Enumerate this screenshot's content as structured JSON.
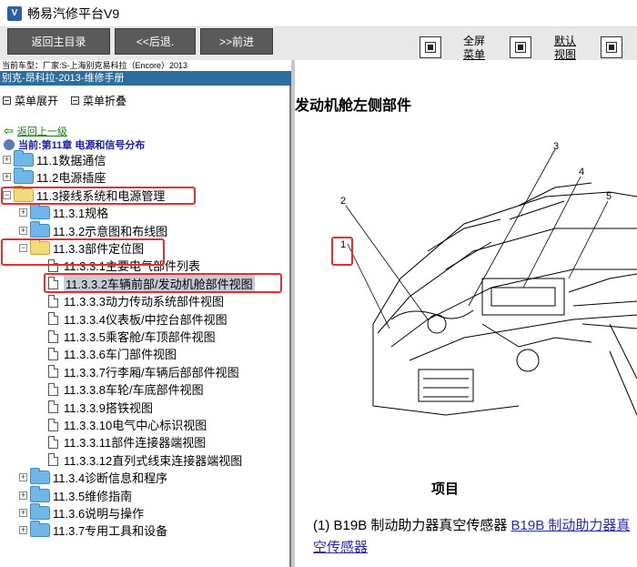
{
  "app": {
    "title": "畅易汽修平台V9",
    "icon_name": "app-icon"
  },
  "toolbar": {
    "back_main": "返回主目录",
    "prev": "<<后退.",
    "next": ">>前进",
    "fullscreen_line1": "全屏",
    "fullscreen_line2": "菜单",
    "default_line1": "默认",
    "default_line2": "视图"
  },
  "model_line": "当前车型：厂家:S-上海别克易科拉（Encore）2013",
  "manual_title": "别克-昂科拉-2013-维修手册",
  "menu": {
    "expand": "菜单展开",
    "collapse": "菜单折叠"
  },
  "nav": {
    "back_up": "返回上一级",
    "current": "当前:第11章 电源和信号分布"
  },
  "tree": [
    {
      "label": "11.1数据通信",
      "type": "folder",
      "toggle": "+"
    },
    {
      "label": "11.2电源插座",
      "type": "folder",
      "toggle": "+"
    },
    {
      "label": "11.3接线系统和电源管理",
      "type": "folder-open",
      "toggle": "−"
    },
    {
      "label": "11.3.1规格",
      "type": "folder",
      "toggle": "+"
    },
    {
      "label": "11.3.2示意图和布线图",
      "type": "folder",
      "toggle": "+"
    },
    {
      "label": "11.3.3部件定位图",
      "type": "folder-open",
      "toggle": "−"
    },
    {
      "label": "11.3.3.1主要电气部件列表",
      "type": "doc"
    },
    {
      "label": "11.3.3.2车辆前部/发动机舱部件视图",
      "type": "doc",
      "selected": true
    },
    {
      "label": "11.3.3.3动力传动系统部件视图",
      "type": "doc"
    },
    {
      "label": "11.3.3.4仪表板/中控台部件视图",
      "type": "doc"
    },
    {
      "label": "11.3.3.5乘客舱/车顶部件视图",
      "type": "doc"
    },
    {
      "label": "11.3.3.6车门部件视图",
      "type": "doc"
    },
    {
      "label": "11.3.3.7行李厢/车辆后部部件视图",
      "type": "doc"
    },
    {
      "label": "11.3.3.8车轮/车底部件视图",
      "type": "doc"
    },
    {
      "label": "11.3.3.9搭铁视图",
      "type": "doc"
    },
    {
      "label": "11.3.3.10电气中心标识视图",
      "type": "doc"
    },
    {
      "label": "11.3.3.11部件连接器端视图",
      "type": "doc"
    },
    {
      "label": "11.3.3.12直列式线束连接器端视图",
      "type": "doc"
    },
    {
      "label": "11.3.4诊断信息和程序",
      "type": "folder",
      "toggle": "+"
    },
    {
      "label": "11.3.5维修指南",
      "type": "folder",
      "toggle": "+"
    },
    {
      "label": "11.3.6说明与操作",
      "type": "folder",
      "toggle": "+"
    },
    {
      "label": "11.3.7专用工具和设备",
      "type": "folder",
      "toggle": "+"
    }
  ],
  "content": {
    "heading": "发动机舱左侧部件",
    "callouts": [
      "1",
      "2",
      "3",
      "4",
      "5"
    ],
    "item_heading": "项目",
    "item_prefix": "(1) B19B 制动助力器真空传感器 ",
    "item_link": "B19B 制动助力器真空传感器"
  },
  "colors": {
    "manual_bar": "#2c6d9e",
    "highlight_box": "#e03131",
    "button_bg": "#5a5a5a"
  }
}
